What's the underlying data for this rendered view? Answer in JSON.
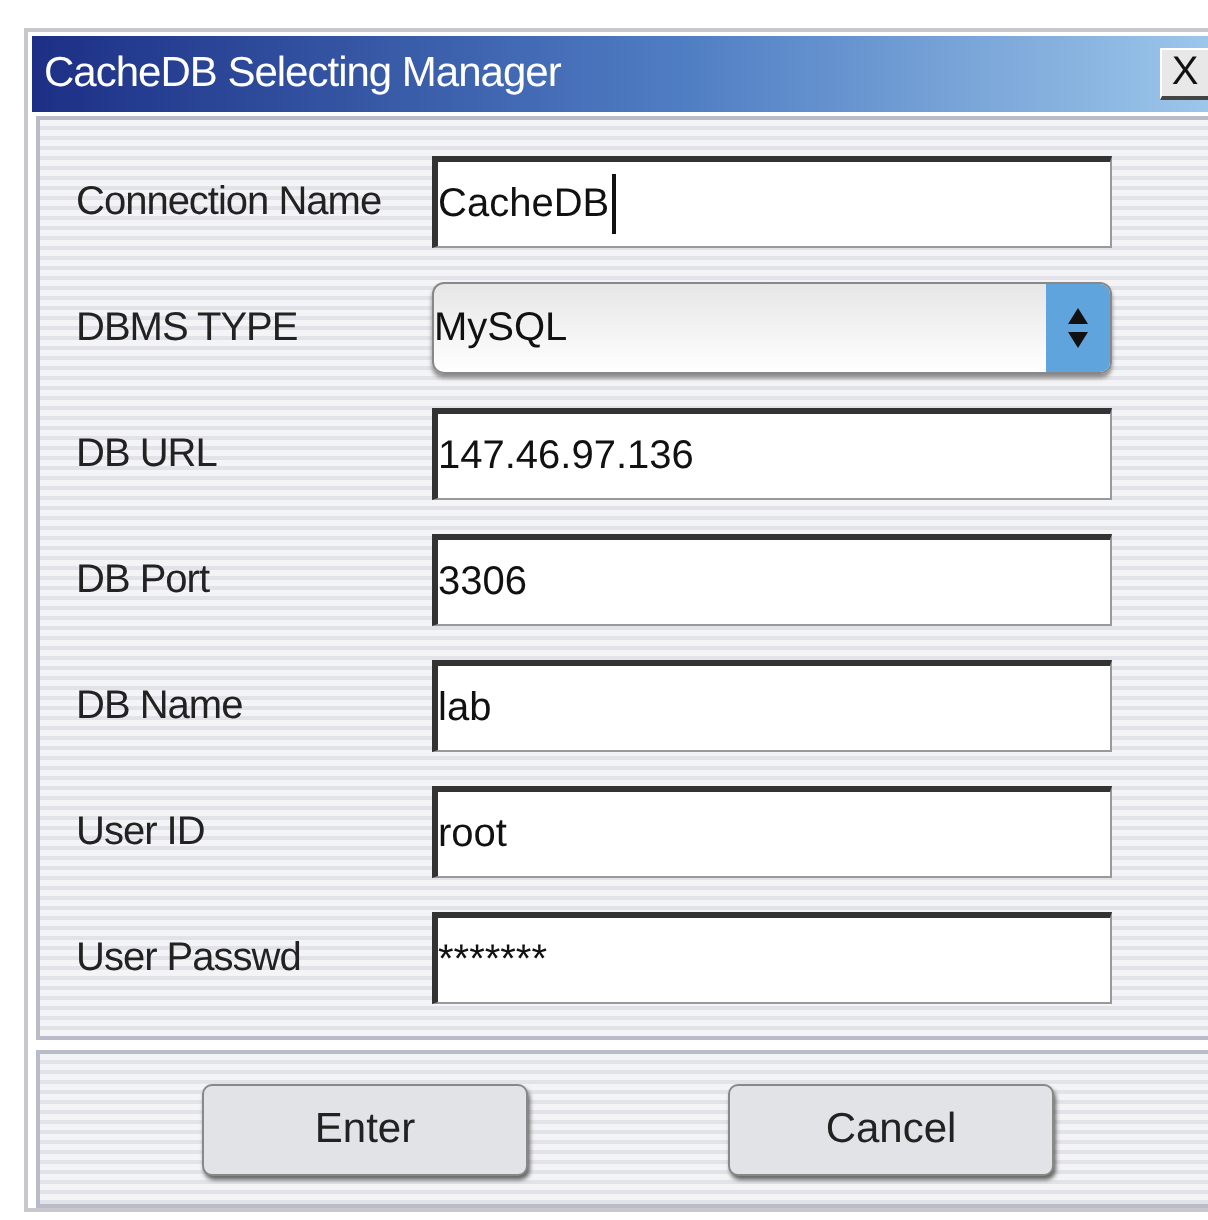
{
  "window": {
    "title": "CacheDB Selecting Manager",
    "close": "X"
  },
  "fields": [
    {
      "label": "Connection Name",
      "kind": "text",
      "value": "CacheDB",
      "focused": true
    },
    {
      "label": "DBMS TYPE",
      "kind": "select",
      "value": "MySQL",
      "focused": false
    },
    {
      "label": "DB URL",
      "kind": "text",
      "value": "147.46.97.136",
      "focused": false
    },
    {
      "label": "DB Port",
      "kind": "text",
      "value": "3306",
      "focused": false
    },
    {
      "label": "DB Name",
      "kind": "text",
      "value": "lab",
      "focused": false
    },
    {
      "label": "User ID",
      "kind": "text",
      "value": "root",
      "focused": false
    },
    {
      "label": "User Passwd",
      "kind": "text",
      "value": "*******",
      "focused": false
    }
  ],
  "buttons": [
    "Enter",
    "Cancel"
  ]
}
